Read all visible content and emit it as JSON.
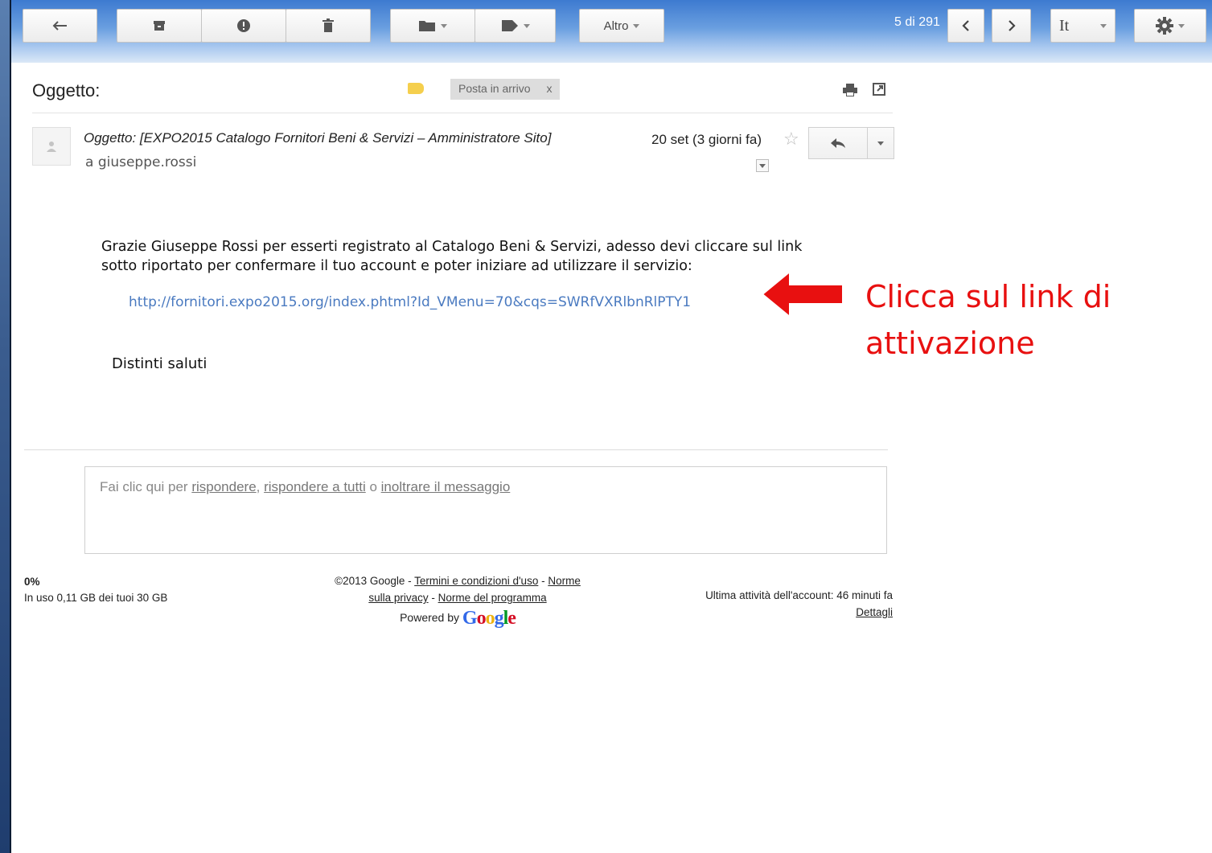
{
  "toolbar": {
    "more_label": "Altro",
    "counter": "5 di 291",
    "language_label": "It"
  },
  "subject_bar": {
    "title": "Oggetto:",
    "label_chip": "Posta in arrivo",
    "label_chip_close": "x"
  },
  "message": {
    "sender": "Oggetto: [EXPO2015 Catalogo Fornitori Beni & Servizi – Amministratore Sito]",
    "recipient": "a giuseppe.rossi",
    "date": "20 set (3 giorni fa)",
    "star": "☆",
    "body_line1": "Grazie Giuseppe Rossi per esserti registrato al Catalogo Beni & Servizi, adesso devi cliccare sul link",
    "body_line2": "sotto riportato per confermare il tuo account e poter iniziare ad utilizzare il servizio:",
    "link": "http://fornitori.expo2015.org/index.phtml?Id_VMenu=70&cqs=SWRfVXRlbnRlPTY1",
    "greeting": "Distinti saluti"
  },
  "annotation": {
    "line1": "Clicca sul link di",
    "line2": "attivazione",
    "color": "#e81010"
  },
  "reply_box": {
    "prefix": "Fai clic qui per ",
    "reply": "rispondere",
    "sep1": ", ",
    "reply_all": "rispondere a tutti",
    "sep2": " o ",
    "forward": "inoltrare il messaggio"
  },
  "footer": {
    "storage_percent": "0%",
    "storage_text": "In uso 0,11 GB dei tuoi 30 GB",
    "copyright": "©2013 Google - ",
    "terms": "Termini e condizioni d'uso",
    "dash1": " - ",
    "privacy_a": "Norme",
    "privacy_b": "sulla privacy",
    "dash2": " - ",
    "program": "Norme del programma",
    "powered_by": "Powered by ",
    "google_logo": "Google",
    "last_activity": "Ultima attività dell'account: 46 minuti fa",
    "details": "Dettagli"
  }
}
